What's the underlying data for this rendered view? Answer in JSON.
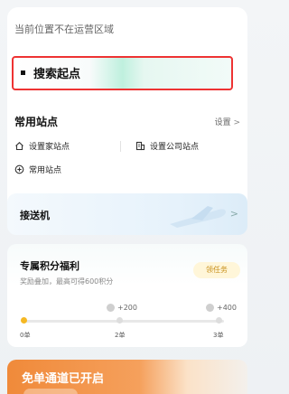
{
  "location": {
    "status_text": "当前位置不在运营区域"
  },
  "search": {
    "label": "搜索起点"
  },
  "common_stations": {
    "title": "常用站点",
    "manage_label": "设置",
    "manage_arrow": ">",
    "home_label": "设置家站点",
    "company_label": "设置公司站点",
    "add_label": "常用站点"
  },
  "pickup": {
    "label": "接送机",
    "arrow": ">"
  },
  "points": {
    "title": "专属积分福利",
    "subtitle": "奖励叠加，最高可得600积分",
    "task_button": "领任务",
    "milestones": [
      {
        "bonus": "",
        "label": "0单"
      },
      {
        "bonus": "+200",
        "label": "2单"
      },
      {
        "bonus": "+400",
        "label": "3单"
      }
    ]
  },
  "banner": {
    "title": "免单通道已开启"
  },
  "colors": {
    "accent": "#f5b823",
    "highlight_border": "#e33",
    "banner": "#f08a3a"
  }
}
